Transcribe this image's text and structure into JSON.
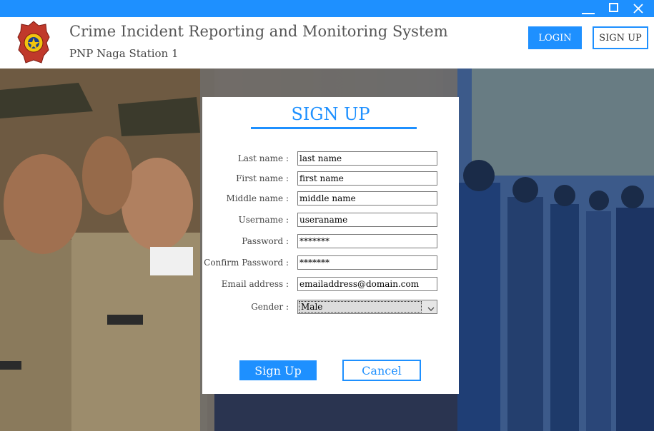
{
  "header": {
    "title": "Crime Incident Reporting and Monitoring System",
    "subtitle": "PNP Naga Station 1",
    "login_label": "LOGIN",
    "signup_label": "SIGN UP"
  },
  "form": {
    "title": "SIGN UP",
    "fields": [
      {
        "label": "Last name :",
        "value": "last name"
      },
      {
        "label": "First name :",
        "value": "first name"
      },
      {
        "label": "Middle name :",
        "value": "middle name"
      },
      {
        "label": "Username :",
        "value": "useraname"
      },
      {
        "label": "Password :",
        "value": "*******"
      },
      {
        "label": "Confirm Password :",
        "value": "*******"
      },
      {
        "label": "Email address :",
        "value": "emailaddress@domain.com"
      }
    ],
    "gender": {
      "label": "Gender :",
      "value": "Male"
    },
    "submit_label": "Sign Up",
    "cancel_label": "Cancel"
  },
  "colors": {
    "accent": "#1e90ff",
    "background": "#ffffff"
  },
  "icons": {
    "minimize": "minimize-icon",
    "maximize": "maximize-icon",
    "close": "close-icon",
    "logo": "pnp-logo",
    "dropdown": "chevron-down-icon"
  }
}
